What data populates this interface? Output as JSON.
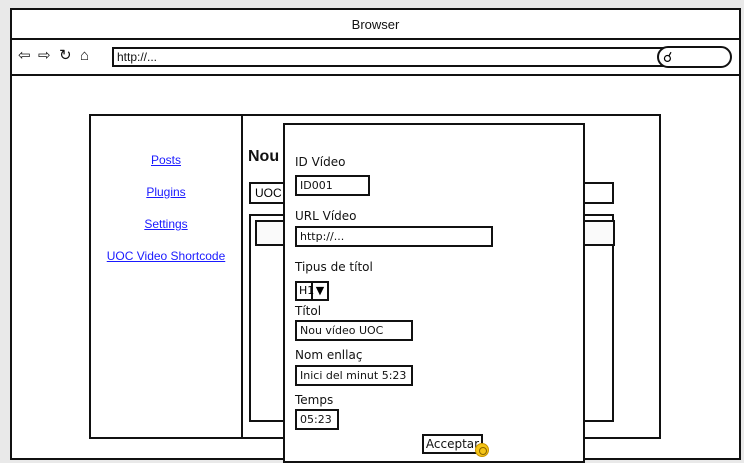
{
  "browser": {
    "title": "Browser",
    "address": "http://...",
    "nav_icons": [
      "back-icon",
      "forward-icon",
      "reload-icon",
      "home-icon"
    ],
    "search_icon": "search-icon"
  },
  "sidebar": {
    "items": [
      {
        "label": "Posts"
      },
      {
        "label": "Plugins"
      },
      {
        "label": "Settings"
      },
      {
        "label": "UOC Video Shortcode"
      }
    ]
  },
  "main": {
    "heading": "Nou",
    "input_value": "UOC"
  },
  "dialog": {
    "video_id_label": "ID Vídeo",
    "video_id_value": "ID001",
    "video_url_label": "URL Vídeo",
    "video_url_value": "http://...",
    "title_type_label": "Tipus de títol",
    "title_type_value": "H1",
    "title_label": "Títol",
    "title_value": "Nou vídeo UOC",
    "link_name_label": "Nom enllaç",
    "link_name_value": "Inici del minut 5:23",
    "time_label": "Temps",
    "time_value": "05:23",
    "accept_label": "Acceptar"
  },
  "colors": {
    "link": "#1a1aff",
    "cursor": "#f5c518"
  }
}
